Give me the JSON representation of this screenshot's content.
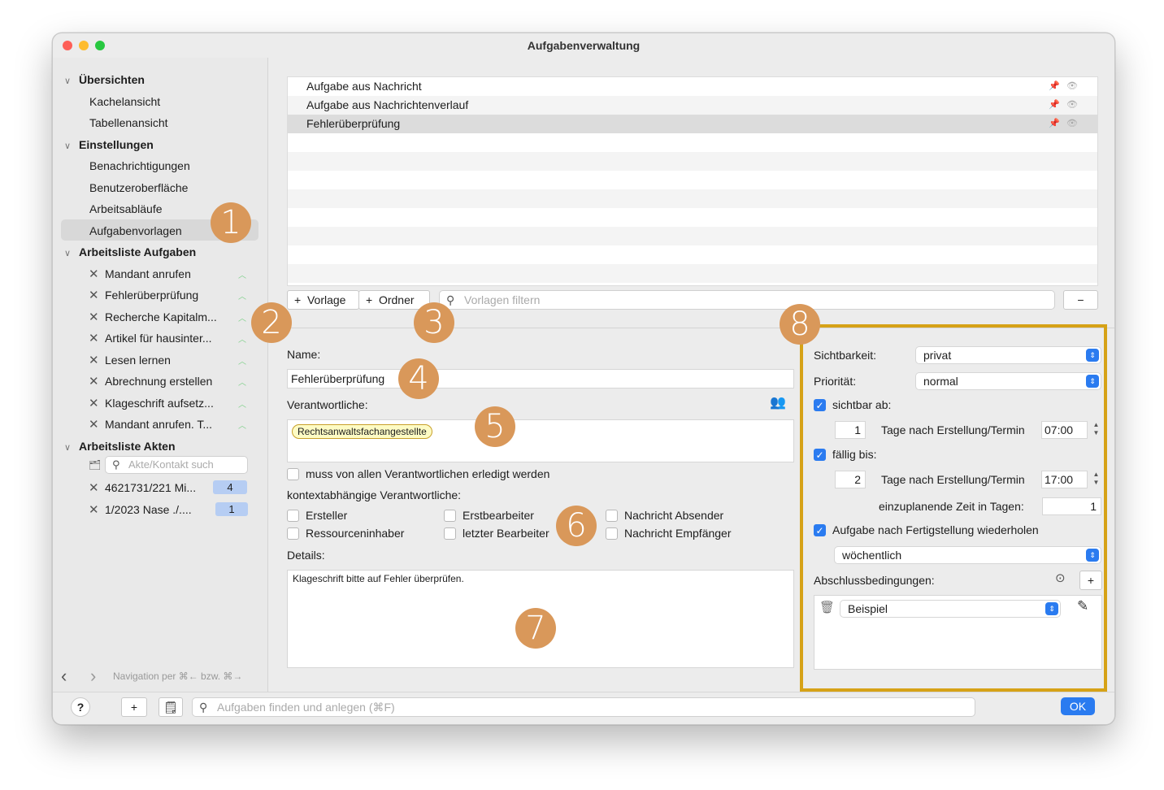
{
  "window": {
    "title": "Aufgabenverwaltung"
  },
  "sidebar": {
    "sections": [
      {
        "label": "Übersichten"
      },
      {
        "label": "Einstellungen"
      },
      {
        "label": "Arbeitsliste Aufgaben"
      },
      {
        "label": "Arbeitsliste Akten"
      }
    ],
    "overview_items": [
      "Kachelansicht",
      "Tabellenansicht"
    ],
    "settings_items": [
      "Benachrichtigungen",
      "Benutzeroberfläche",
      "Arbeitsabläufe",
      "Aufgabenvorlagen"
    ],
    "tasks": [
      "Mandant anrufen",
      "Fehlerüberprüfung",
      "Recherche Kapitalm...",
      "Artikel für hausinter...",
      "Lesen lernen",
      "Abrechnung erstellen",
      "Klageschrift aufsetz...",
      "Mandant anrufen. T..."
    ],
    "akten_search_placeholder": "Akte/Kontakt such",
    "akten": [
      {
        "label": "4621731/221 Mi...",
        "badge": "4"
      },
      {
        "label": "1/2023 Nase ./....",
        "badge": "1"
      }
    ],
    "nav_hint": "Navigation per ⌘← bzw. ⌘→"
  },
  "templates": {
    "rows": [
      "Aufgabe aus Nachricht",
      "Aufgabe aus Nachrichtenverlauf",
      "Fehlerüberprüfung"
    ],
    "add_template": "Vorlage",
    "add_folder": "Ordner",
    "filter_placeholder": "Vorlagen filtern"
  },
  "form": {
    "name_label": "Name:",
    "name_value": "Fehlerüberprüfung",
    "responsible_label": "Verantwortliche:",
    "responsible_token": "Rechtsanwaltsfachangestellte",
    "all_must_complete": "muss von allen Verantwortlichen erledigt werden",
    "contextual_label": "kontextabhängige Verantwortliche:",
    "contextual": [
      "Ersteller",
      "Erstbearbeiter",
      "Nachricht Absender",
      "Ressourceninhaber",
      "letzter Bearbeiter",
      "Nachricht Empfänger"
    ],
    "details_label": "Details:",
    "details_value": "Klageschrift bitte auf Fehler überprüfen."
  },
  "right_panel": {
    "visibility_label": "Sichtbarkeit:",
    "visibility_value": "privat",
    "priority_label": "Priorität:",
    "priority_value": "normal",
    "visible_from_label": "sichtbar ab:",
    "visible_from_days": "1",
    "days_after": "Tage nach Erstellung/Termin",
    "visible_from_time": "07:00",
    "due_label": "fällig bis:",
    "due_days": "2",
    "due_time": "17:00",
    "planned_time_label": "einzuplanende Zeit in Tagen:",
    "planned_time_value": "1",
    "repeat_label": "Aufgabe nach Fertigstellung wiederholen",
    "repeat_value": "wöchentlich",
    "conditions_label": "Abschlussbedingungen:",
    "condition_value": "Beispiel"
  },
  "bottom": {
    "help": "?",
    "add": "+",
    "search_placeholder": "Aufgaben finden und anlegen (⌘F)",
    "ok": "OK"
  },
  "markers": [
    "1",
    "2",
    "3",
    "4",
    "5",
    "6",
    "7",
    "8"
  ],
  "colors": {
    "accent": "#2a7bf0",
    "marker": "#d9985a",
    "highlight_border": "#d6a217",
    "badge": "#b6cdf3",
    "token_bg": "#fdfbc4"
  }
}
